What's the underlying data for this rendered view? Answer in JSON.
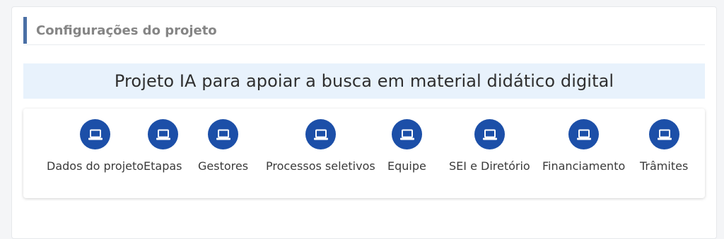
{
  "section": {
    "title": "Configurações do projeto"
  },
  "project": {
    "name": "Projeto IA para apoiar a busca em material didático digital"
  },
  "menu": {
    "icon": "laptop-icon",
    "accent_color": "#1c4fa8",
    "items": [
      {
        "label": "Dados do projeto"
      },
      {
        "label": "Etapas"
      },
      {
        "label": "Gestores"
      },
      {
        "label": "Processos seletivos"
      },
      {
        "label": "Equipe"
      },
      {
        "label": "SEI e Diretório"
      },
      {
        "label": "Financiamento"
      },
      {
        "label": "Trâmites"
      }
    ]
  }
}
